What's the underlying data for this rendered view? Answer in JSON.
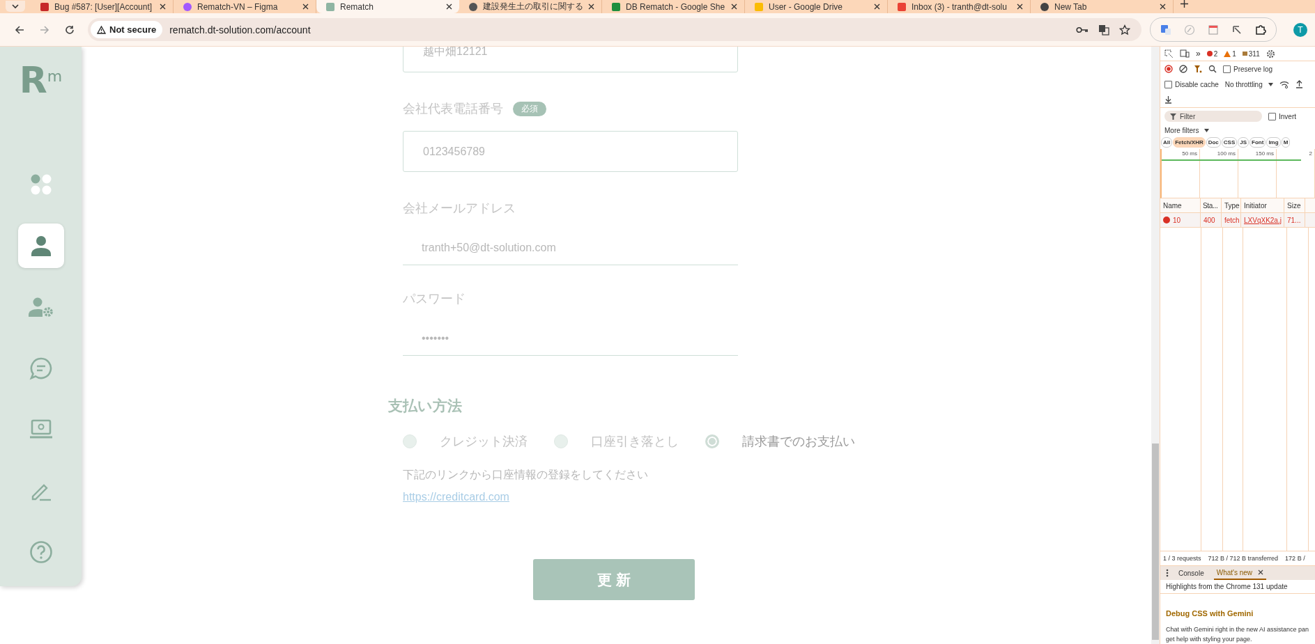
{
  "browser": {
    "tabs": [
      {
        "title": "Bug #587: [User][Account]",
        "selected": false,
        "kind": "bug"
      },
      {
        "title": "Rematch-VN – Figma",
        "selected": false,
        "kind": "figma"
      },
      {
        "title": "Rematch",
        "selected": true,
        "kind": "rematch"
      },
      {
        "title": "建設発生土の取引に関する",
        "selected": false,
        "kind": "globe"
      },
      {
        "title": "DB Rematch - Google She",
        "selected": false,
        "kind": "sheets"
      },
      {
        "title": "User - Google Drive",
        "selected": false,
        "kind": "drive"
      },
      {
        "title": "Inbox (3) - tranth@dt-solu",
        "selected": false,
        "kind": "mail"
      },
      {
        "title": "New Tab",
        "selected": false,
        "kind": "chrome"
      }
    ],
    "security": "Not secure",
    "url": "rematch.dt-solution.com/account",
    "avatar": "T"
  },
  "sidebar": {
    "logo": "Rm",
    "items": [
      {
        "kind": "dashboard",
        "selected": false
      },
      {
        "kind": "user",
        "selected": true
      },
      {
        "kind": "user-settings",
        "selected": false
      },
      {
        "kind": "chat",
        "selected": false
      },
      {
        "kind": "laptop",
        "selected": false
      },
      {
        "kind": "pen",
        "selected": false
      },
      {
        "kind": "help",
        "selected": false
      }
    ]
  },
  "form": {
    "fields": [
      {
        "kind": "boxed",
        "value": "越中畑12121"
      },
      {
        "kind": "boxed",
        "label": "会社代表電話番号",
        "badge": "必須",
        "value": "0123456789"
      },
      {
        "kind": "underline",
        "label": "会社メールアドレス",
        "value": "tranth+50@dt-solution.com"
      },
      {
        "kind": "underline",
        "label": "パスワード",
        "value": "•••••••"
      }
    ],
    "payment": {
      "title": "支払い方法",
      "options": [
        {
          "label": "クレジット決済",
          "selected": false
        },
        {
          "label": "口座引き落とし",
          "selected": false
        },
        {
          "label": "請求書でのお支払い",
          "selected": true
        }
      ],
      "note": "下記のリンクから口座情報の登録をしてください",
      "link": "https://creditcard.com"
    },
    "submit": "更 新"
  },
  "devtools": {
    "more": "»",
    "errors": "2",
    "warnings": "1",
    "messages": "311",
    "preserve_log": {
      "label": "Preserve log",
      "checked": false
    },
    "disable_cache": {
      "label": "Disable cache",
      "checked": false
    },
    "throttling": "No throttling",
    "filter": {
      "placeholder": "Filter"
    },
    "invert": {
      "label": "Invert",
      "checked": false
    },
    "more_filters": "More filters",
    "chips": [
      {
        "label": "All",
        "selected": false
      },
      {
        "label": "Fetch/XHR",
        "selected": true
      },
      {
        "label": "Doc",
        "selected": false
      },
      {
        "label": "CSS",
        "selected": false
      },
      {
        "label": "JS",
        "selected": false
      },
      {
        "label": "Font",
        "selected": false
      },
      {
        "label": "Img",
        "selected": false
      },
      {
        "label": "M",
        "selected": false
      }
    ],
    "timeline_ticks": [
      "50 ms",
      "100 ms",
      "150 ms",
      "2"
    ],
    "columns": [
      "Name",
      "Sta...",
      "Type",
      "Initiator",
      "Size"
    ],
    "rows": [
      {
        "error": true,
        "cells": [
          "10",
          "400",
          "fetch",
          "LXVqXK2a.j",
          "71..."
        ]
      }
    ],
    "status": [
      "1 / 3 requests",
      "712 B / 712 B transferred",
      "172 B /"
    ],
    "drawer_tabs": [
      {
        "label": "Console",
        "selected": false
      },
      {
        "label": "What's new",
        "selected": true
      }
    ],
    "highlights": "Highlights from the Chrome 131 update",
    "heading": "Debug CSS with Gemini",
    "body_lines": [
      "Chat with Gemini right in the new AI assistance pan",
      "get help with styling your page."
    ]
  }
}
